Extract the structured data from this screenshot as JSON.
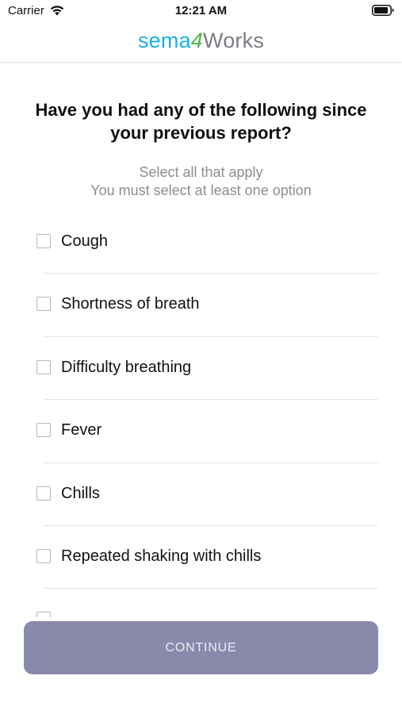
{
  "status_bar": {
    "carrier": "Carrier",
    "time": "12:21 AM"
  },
  "header": {
    "logo_part1": "sema",
    "logo_part2": "4",
    "logo_part3": "Works"
  },
  "question": {
    "title": "Have you had any of the following since your previous report?",
    "hint_line1": "Select all  that apply",
    "hint_line2": "You must select at least one option"
  },
  "options": [
    {
      "label": "Cough",
      "checked": false
    },
    {
      "label": "Shortness of breath",
      "checked": false
    },
    {
      "label": "Difficulty breathing",
      "checked": false
    },
    {
      "label": "Fever",
      "checked": false
    },
    {
      "label": "Chills",
      "checked": false
    },
    {
      "label": "Repeated shaking with chills",
      "checked": false
    },
    {
      "label": "",
      "checked": false
    }
  ],
  "continue_button": {
    "label": "CONTINUE"
  },
  "colors": {
    "brand_blue": "#1ab0e0",
    "brand_green": "#4cb84c",
    "brand_gray": "#7d7d86",
    "button_bg": "#8889ab"
  }
}
